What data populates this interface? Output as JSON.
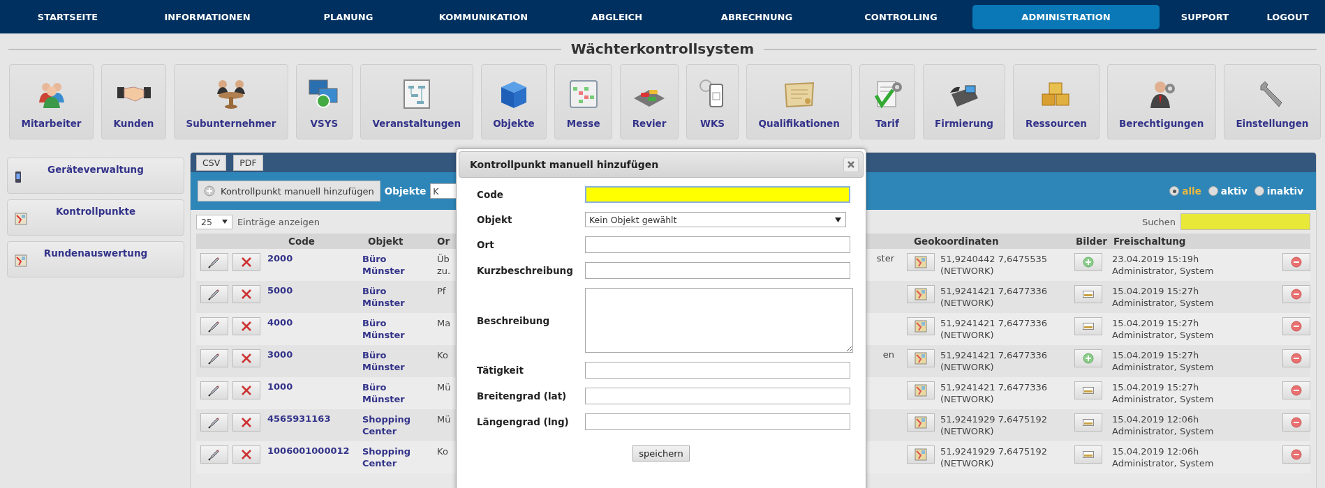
{
  "nav": [
    {
      "label": "STARTSEITE",
      "selected": false
    },
    {
      "label": "INFORMATIONEN",
      "selected": false
    },
    {
      "label": "PLANUNG",
      "selected": false
    },
    {
      "label": "KOMMUNIKATION",
      "selected": false
    },
    {
      "label": "ABGLEICH",
      "selected": false
    },
    {
      "label": "ABRECHNUNG",
      "selected": false
    },
    {
      "label": "CONTROLLING",
      "selected": false
    },
    {
      "label": "ADMINISTRATION",
      "selected": true
    },
    {
      "label": "SUPPORT",
      "selected": false
    },
    {
      "label": "LOGOUT",
      "selected": false
    }
  ],
  "page_title": "Wächterkontrollsystem",
  "modules": [
    {
      "label": "Mitarbeiter"
    },
    {
      "label": "Kunden"
    },
    {
      "label": "Subunternehmer"
    },
    {
      "label": "VSYS"
    },
    {
      "label": "Veranstaltungen"
    },
    {
      "label": "Objekte"
    },
    {
      "label": "Messe"
    },
    {
      "label": "Revier"
    },
    {
      "label": "WKS"
    },
    {
      "label": "Qualifikationen"
    },
    {
      "label": "Tarif"
    },
    {
      "label": "Firmierung"
    },
    {
      "label": "Ressourcen"
    },
    {
      "label": "Berechtigungen"
    },
    {
      "label": "Einstellungen"
    }
  ],
  "sidebar": [
    {
      "label": "Geräteverwaltung",
      "kind": "device"
    },
    {
      "label": "Kontrollpunkte",
      "kind": "map"
    },
    {
      "label": "Rundenauswertung",
      "kind": "map"
    }
  ],
  "export_buttons": [
    "CSV",
    "PDF"
  ],
  "toolbar": {
    "add_button": "Kontrollpunkt manuell hinzufügen",
    "objects_label": "Objekte",
    "objects_select": "K",
    "filters": [
      {
        "label": "alle",
        "selected": true
      },
      {
        "label": "aktiv",
        "selected": false
      },
      {
        "label": "inaktiv",
        "selected": false
      }
    ]
  },
  "page_size": {
    "value": "25",
    "label": "Einträge anzeigen"
  },
  "search": {
    "label": "Suchen"
  },
  "table": {
    "columns": [
      "Code",
      "Objekt",
      "Or",
      "Geokoordinaten",
      "Bilder",
      "Freischaltung"
    ],
    "rows": [
      {
        "code": "2000",
        "object": "Büro Münster",
        "ort": [
          "Üb",
          "zu."
        ],
        "tail": "ster",
        "coordinates": "51,9240442 7,6475535",
        "source": "(NETWORK)",
        "image_button": {
          "kind": "add"
        },
        "date": "23.04.2019 15:19h",
        "user": "Administrator, System"
      },
      {
        "code": "5000",
        "object": "Büro Münster",
        "ort": [
          "Pf"
        ],
        "coordinates": "51,9241421 7,6477336",
        "source": "(NETWORK)",
        "image_button": {
          "kind": "image"
        },
        "date": "15.04.2019 15:27h",
        "user": "Administrator, System"
      },
      {
        "code": "4000",
        "object": "Büro Münster",
        "ort": [
          "Ma"
        ],
        "coordinates": "51,9241421 7,6477336",
        "source": "(NETWORK)",
        "image_button": {
          "kind": "image"
        },
        "date": "15.04.2019 15:27h",
        "user": "Administrator, System"
      },
      {
        "code": "3000",
        "object": "Büro Münster",
        "ort": [
          "Ko"
        ],
        "tail": "en",
        "coordinates": "51,9241421 7,6477336",
        "source": "(NETWORK)",
        "image_button": {
          "kind": "add"
        },
        "date": "15.04.2019 15:27h",
        "user": "Administrator, System"
      },
      {
        "code": "1000",
        "object": "Büro Münster",
        "ort": [
          "Mü"
        ],
        "coordinates": "51,9241421 7,6477336",
        "source": "(NETWORK)",
        "image_button": {
          "kind": "image"
        },
        "date": "15.04.2019 15:27h",
        "user": "Administrator, System"
      },
      {
        "code": "4565931163",
        "object": "Shopping Center",
        "ort": [
          "Mü"
        ],
        "coordinates": "51,9241929 7,6475192",
        "source": "(NETWORK)",
        "image_button": {
          "kind": "image"
        },
        "date": "15.04.2019 12:06h",
        "user": "Administrator, System"
      },
      {
        "code": "1006001000012",
        "object": "Shopping Center",
        "ort": [
          "Ko"
        ],
        "coordinates": "51,9241929 7,6475192",
        "source": "(NETWORK)",
        "image_button": {
          "kind": "image"
        },
        "date": "15.04.2019 12:06h",
        "user": "Administrator, System"
      }
    ]
  },
  "dialog": {
    "title": "Kontrollpunkt manuell hinzufügen",
    "fields": [
      {
        "label": "Code",
        "kind": "text",
        "focused": true
      },
      {
        "label": "Objekt",
        "kind": "select",
        "value": "Kein Objekt gewählt",
        "focused": false
      },
      {
        "label": "Ort",
        "kind": "text",
        "focused": false
      },
      {
        "label": "Kurzbeschreibung",
        "kind": "text",
        "focused": false
      },
      {
        "label": "Beschreibung",
        "kind": "textarea",
        "focused": false
      },
      {
        "label": "Tätigkeit",
        "kind": "text",
        "focused": false
      },
      {
        "label": "Breitengrad (lat)",
        "kind": "text",
        "focused": false
      },
      {
        "label": "Längengrad (lng)",
        "kind": "text",
        "focused": false
      }
    ],
    "save_button": "speichern"
  }
}
